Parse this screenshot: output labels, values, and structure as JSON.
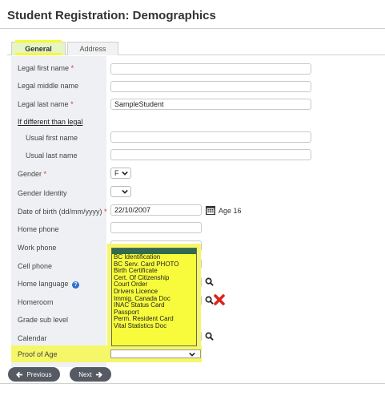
{
  "page": {
    "title": "Student Registration: Demographics"
  },
  "tabs": [
    {
      "label": "General",
      "active": true
    },
    {
      "label": "Address",
      "active": false
    }
  ],
  "fields": {
    "legal_first_name": {
      "label": "Legal first name",
      "required_mark": "*",
      "value": ""
    },
    "legal_middle_name": {
      "label": "Legal middle name",
      "value": ""
    },
    "legal_last_name": {
      "label": "Legal last name",
      "required_mark": "*",
      "value": "SampleStudent"
    },
    "if_different": {
      "label": "If different than legal"
    },
    "usual_first_name": {
      "label": "Usual first name",
      "value": ""
    },
    "usual_last_name": {
      "label": "Usual last name",
      "value": ""
    },
    "gender": {
      "label": "Gender",
      "required_mark": "*",
      "value": "F"
    },
    "gender_identity": {
      "label": "Gender Identity",
      "value": ""
    },
    "dob": {
      "label": "Date of birth (dd/mm/yyyy)",
      "required_mark": "*",
      "value": "22/10/2007",
      "age_text": "Age 16"
    },
    "home_phone": {
      "label": "Home phone",
      "value": ""
    },
    "work_phone": {
      "label": "Work phone"
    },
    "cell_phone": {
      "label": "Cell phone"
    },
    "home_language": {
      "label": "Home language"
    },
    "homeroom": {
      "label": "Homeroom"
    },
    "grade_sub_level": {
      "label": "Grade sub level"
    },
    "calendar": {
      "label": "Calendar"
    },
    "proof_of_age": {
      "label": "Proof of Age",
      "value": "",
      "options": [
        "BC Identification",
        "BC Serv. Card PHOTO",
        "Birth Certificate",
        "Cert. Of Citizenship",
        "Court Order",
        "Drivers Licence",
        "Immig. Canada Doc",
        "INAC Status Card",
        "Passport",
        "Perm. Resident Card",
        "Vital Statistics Doc"
      ]
    }
  },
  "buttons": {
    "previous": "Previous",
    "next": "Next"
  },
  "colors": {
    "highlight": "#f5f768",
    "label_column": "#eef0f3",
    "button": "#555a63",
    "delete_red": "#e0201b"
  },
  "icons": [
    "calendar-icon",
    "search-icon",
    "delete-icon",
    "help-icon",
    "chevron-down-icon",
    "arrow-left-icon",
    "arrow-right-icon"
  ]
}
